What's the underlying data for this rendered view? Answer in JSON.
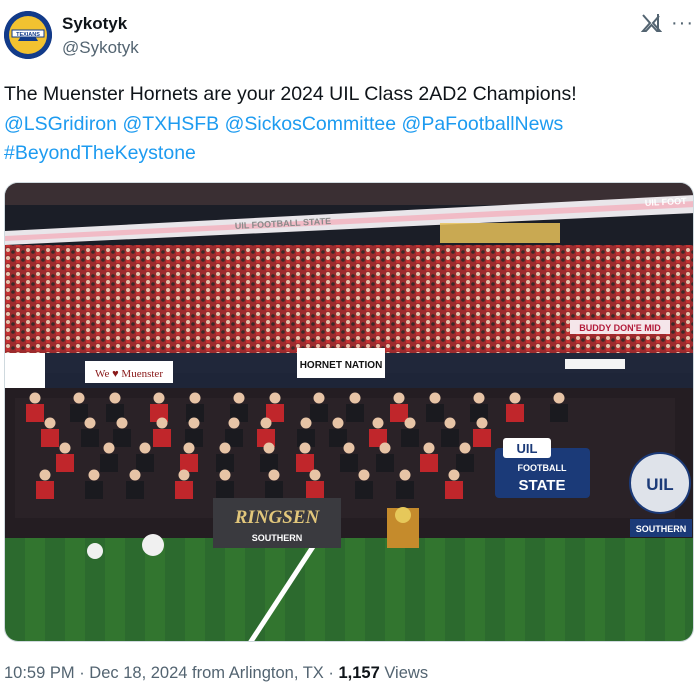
{
  "author": {
    "display_name": "Sykotyk",
    "handle": "@Sykotyk",
    "avatar_text": "TEXIANS"
  },
  "header_icons": [
    "grok-icon",
    "more-icon"
  ],
  "more_glyph": "···",
  "tweet": {
    "text_intro": "The Muenster Hornets are your 2024 UIL Class 2AD2 Champions!",
    "mentions": [
      "@LSGridiron",
      "@TXHSFB",
      "@SickosCommittee",
      "@PaFootballNews"
    ],
    "hashtag": "#BeyondTheKeystone"
  },
  "photo": {
    "banner_left": "UIL FOOTBALL STATE",
    "banner_right": "UIL FOOT",
    "signs": [
      "We ♥ Muenster",
      "HORNET NATION",
      "BUDDY DON'E MID"
    ],
    "ring_banner": "RINGSEN",
    "ring_sub": "SOUTHERN",
    "logo_uil": "UIL",
    "logo_football": "FOOTBALL",
    "logo_state": "STATE",
    "badge_uil": "UIL",
    "badge_sub": "SOUTHERN"
  },
  "meta": {
    "time": "10:59 PM",
    "sep1": " · ",
    "date": "Dec 18, 2024",
    "location": " from Arlington, TX",
    "sep2": " · ",
    "views_count": "1,157",
    "views_label": " Views"
  },
  "colors": {
    "link": "#1d9bf0",
    "secondary_text": "#536471",
    "turf": "#2f6b2f",
    "crowd_red": "#b52a2a"
  }
}
